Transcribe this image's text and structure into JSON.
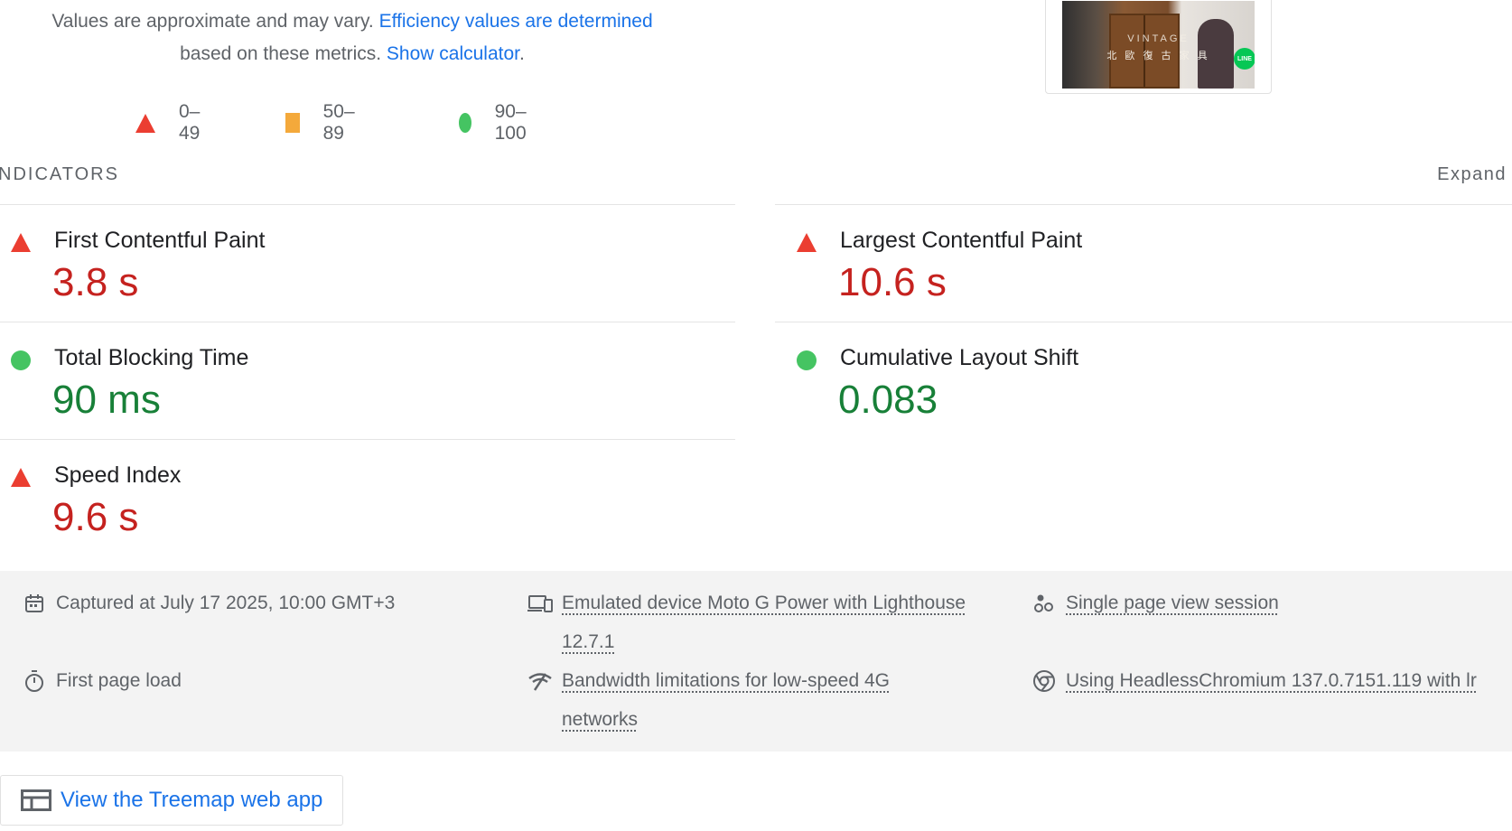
{
  "note": {
    "text_before": "Values are approximate and may vary. ",
    "link_efficiency": "Efficiency values are determined",
    "text_middle": " based on these metrics.  ",
    "link_calculator": "Show calculator",
    "text_after": "."
  },
  "legend": [
    {
      "shape": "triangle",
      "label": "0–49",
      "color": "#eb3e31"
    },
    {
      "shape": "square",
      "label": "50–89",
      "color": "#f4a93b"
    },
    {
      "shape": "circle",
      "label": "90–100",
      "color": "#45c462"
    }
  ],
  "thumbnail": {
    "vintage_text": "VINTAGE",
    "cjk_text": "北 歐 復 古 家 具",
    "badge_text": "LINE"
  },
  "section": {
    "heading": "NDICATORS",
    "expand_label": "Expand"
  },
  "metrics": {
    "fcp": {
      "name": "First Contentful Paint",
      "value": "3.8 s",
      "rating": "poor"
    },
    "lcp": {
      "name": "Largest Contentful Paint",
      "value": "10.6 s",
      "rating": "poor"
    },
    "tbt": {
      "name": "Total Blocking Time",
      "value": "90 ms",
      "rating": "good"
    },
    "cls": {
      "name": "Cumulative Layout Shift",
      "value": "0.083",
      "rating": "good"
    },
    "si": {
      "name": "Speed Index",
      "value": "9.6 s",
      "rating": "poor"
    }
  },
  "meta": {
    "captured": "Captured at July 17 2025, 10:00 GMT+3",
    "device_line1": "Emulated device Moto G Power with Lighthouse",
    "device_line2": "12.7.1",
    "session": "Single page view session",
    "load": "First page load",
    "bandwidth_line1": "Bandwidth limitations for low-speed 4G",
    "bandwidth_line2": "networks",
    "browser": "Using HeadlessChromium 137.0.7151.119 with lr"
  },
  "treemap": {
    "label": "View the Treemap web app"
  },
  "colors": {
    "link": "#1a73e8",
    "poor": "#c5221f",
    "good": "#188038",
    "poor_icon": "#eb3e31",
    "average_icon": "#f4a93b",
    "good_icon": "#45c462"
  }
}
